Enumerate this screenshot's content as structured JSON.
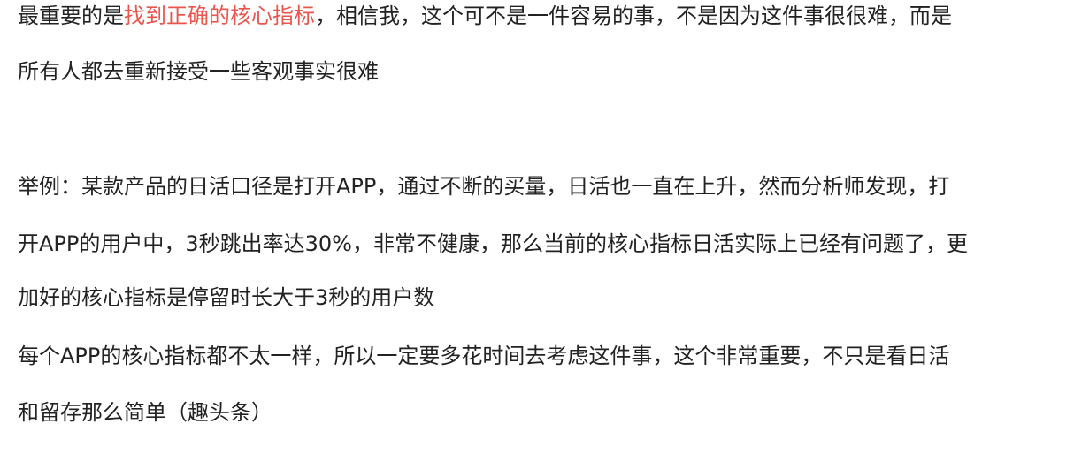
{
  "paragraph1": {
    "prefix": "最重要的是",
    "highlight": "找到正确的核心指标",
    "suffix": "，相信我，这个可不是一件容易的事，不是因为这件事很很难，而是",
    "line2": "所有人都去重新接受一些客观事实很难"
  },
  "paragraph2": {
    "line1": "举例：某款产品的日活口径是打开APP，通过不断的买量，日活也一直在上升，然而分析师发现，打",
    "line2": "开APP的用户中，3秒跳出率达30%，非常不健康，那么当前的核心指标日活实际上已经有问题了，更",
    "line3": "加好的核心指标是停留时长大于3秒的用户数"
  },
  "paragraph3": {
    "line1": "每个APP的核心指标都不太一样，所以一定要多花时间去考虑这件事，这个非常重要，不只是看日活",
    "line2": "和留存那么简单（趣头条）"
  },
  "colors": {
    "text": "#222222",
    "highlight": "#e8564c",
    "background": "#ffffff"
  }
}
